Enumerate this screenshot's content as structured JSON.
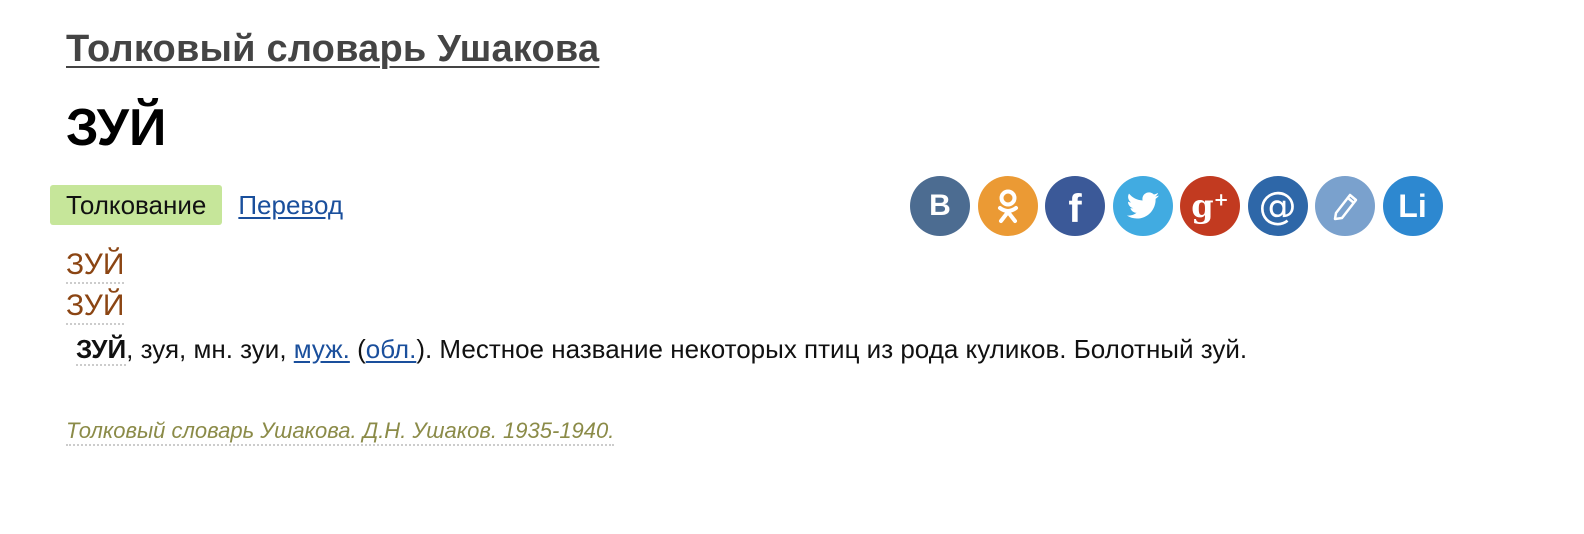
{
  "dictionary_title": "Толковый словарь Ушакова",
  "headword": "ЗУЙ",
  "tabs": {
    "active": "Толкование",
    "link": "Перевод"
  },
  "social": [
    {
      "name": "vk",
      "label": "B",
      "color": "#4c6c91"
    },
    {
      "name": "odnoklassniki",
      "label": "ok",
      "color": "#eb9a34"
    },
    {
      "name": "facebook",
      "label": "f",
      "color": "#3b5998"
    },
    {
      "name": "twitter",
      "label": "bird",
      "color": "#41abe1"
    },
    {
      "name": "google-plus",
      "label": "g+",
      "color": "#c23a20"
    },
    {
      "name": "mail",
      "label": "@",
      "color": "#2e67a8"
    },
    {
      "name": "livejournal",
      "label": "pencil",
      "color": "#7aa1cd"
    },
    {
      "name": "liveinternet",
      "label": "Li",
      "color": "#2d88d0"
    }
  ],
  "variants": [
    "ЗУЙ",
    "ЗУЙ"
  ],
  "definition": {
    "word": "ЗУЙ",
    "forms": ", зуя, мн. зуи, ",
    "gender_link": "муж.",
    "region_link": "обл.",
    "text": "). Местное название некоторых птиц из рода куликов. Болотный зуй."
  },
  "source": "Толковый словарь Ушакова. Д.Н. Ушаков. 1935-1940."
}
